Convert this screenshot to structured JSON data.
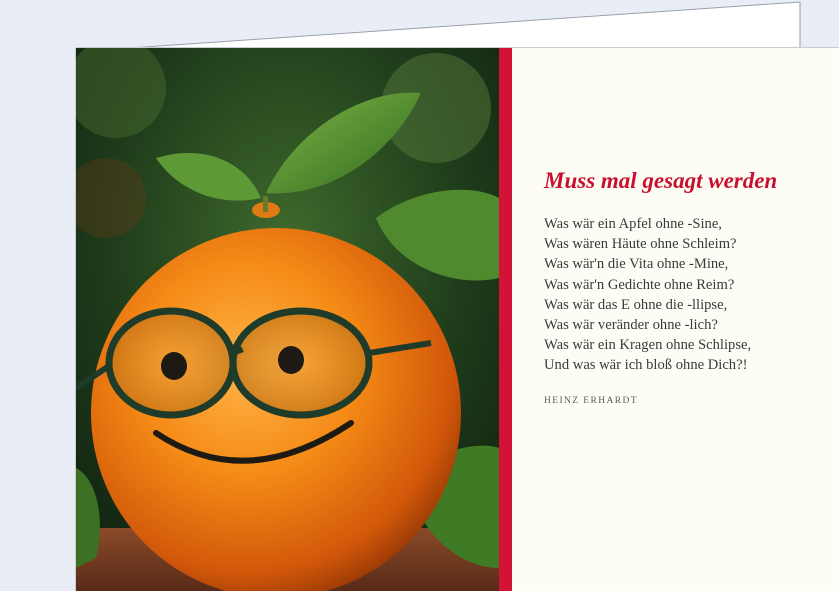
{
  "card": {
    "title": "Muss mal gesagt werden",
    "lines": [
      "Was wär ein Apfel ohne -Sine,",
      "Was wären Häute ohne Schleim?",
      "Was wär'n die Vita ohne -Mine,",
      "Was wär'n Gedichte ohne Reim?",
      "Was wär das E ohne die -llipse,",
      "Was wär veränder ohne -lich?",
      "Was wär ein Kragen ohne Schlipse,",
      "Und was wär ich bloß ohne Dich?!"
    ],
    "author": "HEINZ ERHARDT"
  },
  "colors": {
    "accent_red": "#c8102e",
    "band_red": "#d31237",
    "paper": "#fdfdf6",
    "background": "#e9edf5"
  }
}
